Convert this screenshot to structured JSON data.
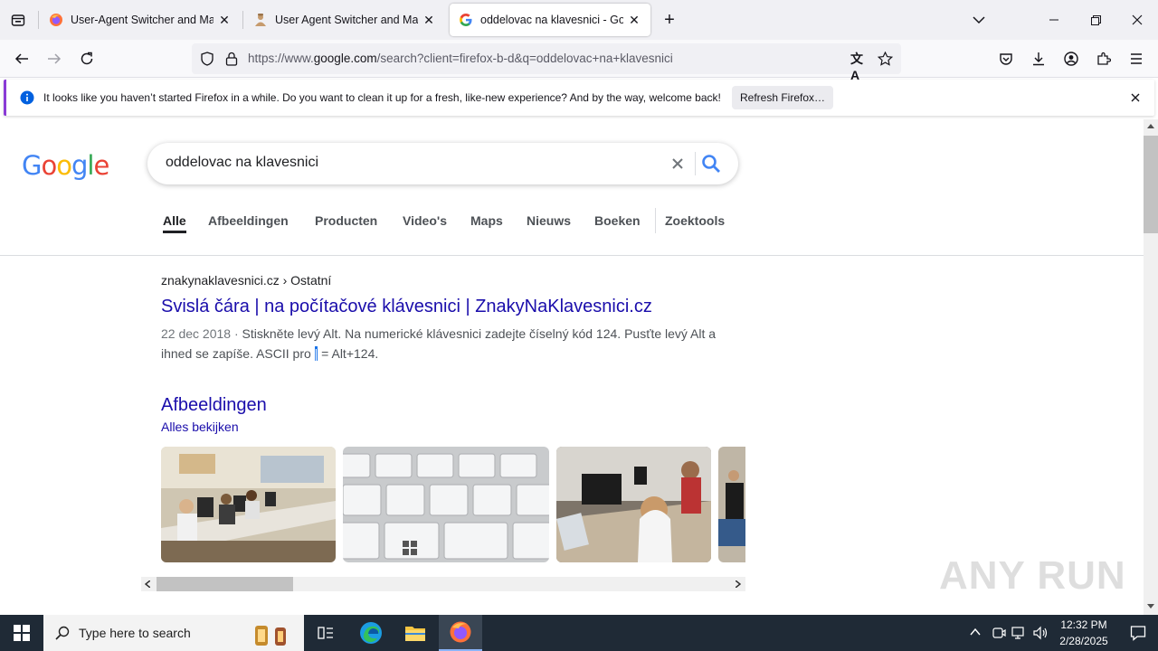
{
  "browser": {
    "tabs": [
      {
        "title": "User-Agent Switcher and Mana",
        "favicon": "firefox-icon",
        "active": false
      },
      {
        "title": "User Agent Switcher and Manag",
        "favicon": "addon-icon",
        "active": false
      },
      {
        "title": "oddelovac na klavesnici - Goog",
        "favicon": "google-g-icon",
        "active": true
      }
    ],
    "url_scheme": "https://www.",
    "url_host": "google.com",
    "url_path": "/search?client=firefox-b-d&q=oddelovac+na+klavesnici",
    "notification": {
      "text": "It looks like you haven’t started Firefox in a while. Do you want to clean it up for a fresh, like-new experience? And by the way, welcome back!",
      "button": "Refresh Firefox…"
    }
  },
  "google": {
    "logo_letters": [
      "G",
      "o",
      "o",
      "g",
      "l",
      "e"
    ],
    "logo_colors": [
      "#4285f4",
      "#ea4335",
      "#fbbc05",
      "#4285f4",
      "#34a853",
      "#ea4335"
    ],
    "query": "oddelovac na klavesnici",
    "tabs": [
      "Alle",
      "Afbeeldingen",
      "Producten",
      "Video's",
      "Maps",
      "Nieuws",
      "Boeken",
      "Zoektools"
    ],
    "result": {
      "cite": "znakynaklavesnici.cz › Ostatní",
      "title": "Svislá čára | na počítačové klávesnici | ZnakyNaKlavesnici.cz",
      "date": "22 dec 2018",
      "snippet_a": "Stiskněte levý Alt. Na numerické klávesnici zadejte číselný kód 124. Pusťte levý Alt a ihned se zapíše. ASCII pro ",
      "snippet_hl": "|",
      "snippet_b": " = Alt+124."
    },
    "images_heading": "Afbeeldingen",
    "images_all": "Alles bekijken"
  },
  "watermark": "ANY RUN",
  "taskbar": {
    "search_placeholder": "Type here to search",
    "time": "12:32 PM",
    "date": "2/28/2025"
  }
}
